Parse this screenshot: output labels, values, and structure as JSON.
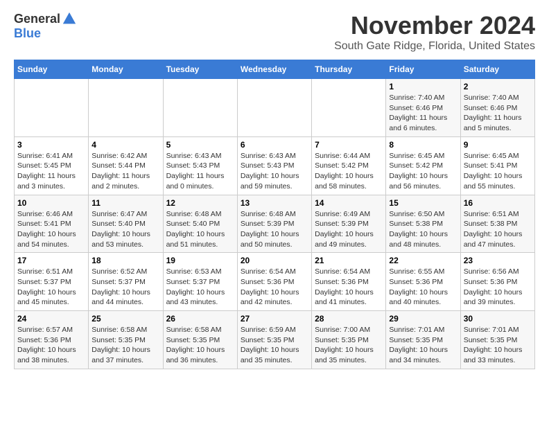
{
  "logo": {
    "general": "General",
    "blue": "Blue"
  },
  "title": {
    "month": "November 2024",
    "location": "South Gate Ridge, Florida, United States"
  },
  "weekdays": [
    "Sunday",
    "Monday",
    "Tuesday",
    "Wednesday",
    "Thursday",
    "Friday",
    "Saturday"
  ],
  "weeks": [
    [
      {
        "day": "",
        "info": ""
      },
      {
        "day": "",
        "info": ""
      },
      {
        "day": "",
        "info": ""
      },
      {
        "day": "",
        "info": ""
      },
      {
        "day": "",
        "info": ""
      },
      {
        "day": "1",
        "info": "Sunrise: 7:40 AM\nSunset: 6:46 PM\nDaylight: 11 hours and 6 minutes."
      },
      {
        "day": "2",
        "info": "Sunrise: 7:40 AM\nSunset: 6:46 PM\nDaylight: 11 hours and 5 minutes."
      }
    ],
    [
      {
        "day": "3",
        "info": "Sunrise: 6:41 AM\nSunset: 5:45 PM\nDaylight: 11 hours and 3 minutes."
      },
      {
        "day": "4",
        "info": "Sunrise: 6:42 AM\nSunset: 5:44 PM\nDaylight: 11 hours and 2 minutes."
      },
      {
        "day": "5",
        "info": "Sunrise: 6:43 AM\nSunset: 5:43 PM\nDaylight: 11 hours and 0 minutes."
      },
      {
        "day": "6",
        "info": "Sunrise: 6:43 AM\nSunset: 5:43 PM\nDaylight: 10 hours and 59 minutes."
      },
      {
        "day": "7",
        "info": "Sunrise: 6:44 AM\nSunset: 5:42 PM\nDaylight: 10 hours and 58 minutes."
      },
      {
        "day": "8",
        "info": "Sunrise: 6:45 AM\nSunset: 5:42 PM\nDaylight: 10 hours and 56 minutes."
      },
      {
        "day": "9",
        "info": "Sunrise: 6:45 AM\nSunset: 5:41 PM\nDaylight: 10 hours and 55 minutes."
      }
    ],
    [
      {
        "day": "10",
        "info": "Sunrise: 6:46 AM\nSunset: 5:41 PM\nDaylight: 10 hours and 54 minutes."
      },
      {
        "day": "11",
        "info": "Sunrise: 6:47 AM\nSunset: 5:40 PM\nDaylight: 10 hours and 53 minutes."
      },
      {
        "day": "12",
        "info": "Sunrise: 6:48 AM\nSunset: 5:40 PM\nDaylight: 10 hours and 51 minutes."
      },
      {
        "day": "13",
        "info": "Sunrise: 6:48 AM\nSunset: 5:39 PM\nDaylight: 10 hours and 50 minutes."
      },
      {
        "day": "14",
        "info": "Sunrise: 6:49 AM\nSunset: 5:39 PM\nDaylight: 10 hours and 49 minutes."
      },
      {
        "day": "15",
        "info": "Sunrise: 6:50 AM\nSunset: 5:38 PM\nDaylight: 10 hours and 48 minutes."
      },
      {
        "day": "16",
        "info": "Sunrise: 6:51 AM\nSunset: 5:38 PM\nDaylight: 10 hours and 47 minutes."
      }
    ],
    [
      {
        "day": "17",
        "info": "Sunrise: 6:51 AM\nSunset: 5:37 PM\nDaylight: 10 hours and 45 minutes."
      },
      {
        "day": "18",
        "info": "Sunrise: 6:52 AM\nSunset: 5:37 PM\nDaylight: 10 hours and 44 minutes."
      },
      {
        "day": "19",
        "info": "Sunrise: 6:53 AM\nSunset: 5:37 PM\nDaylight: 10 hours and 43 minutes."
      },
      {
        "day": "20",
        "info": "Sunrise: 6:54 AM\nSunset: 5:36 PM\nDaylight: 10 hours and 42 minutes."
      },
      {
        "day": "21",
        "info": "Sunrise: 6:54 AM\nSunset: 5:36 PM\nDaylight: 10 hours and 41 minutes."
      },
      {
        "day": "22",
        "info": "Sunrise: 6:55 AM\nSunset: 5:36 PM\nDaylight: 10 hours and 40 minutes."
      },
      {
        "day": "23",
        "info": "Sunrise: 6:56 AM\nSunset: 5:36 PM\nDaylight: 10 hours and 39 minutes."
      }
    ],
    [
      {
        "day": "24",
        "info": "Sunrise: 6:57 AM\nSunset: 5:36 PM\nDaylight: 10 hours and 38 minutes."
      },
      {
        "day": "25",
        "info": "Sunrise: 6:58 AM\nSunset: 5:35 PM\nDaylight: 10 hours and 37 minutes."
      },
      {
        "day": "26",
        "info": "Sunrise: 6:58 AM\nSunset: 5:35 PM\nDaylight: 10 hours and 36 minutes."
      },
      {
        "day": "27",
        "info": "Sunrise: 6:59 AM\nSunset: 5:35 PM\nDaylight: 10 hours and 35 minutes."
      },
      {
        "day": "28",
        "info": "Sunrise: 7:00 AM\nSunset: 5:35 PM\nDaylight: 10 hours and 35 minutes."
      },
      {
        "day": "29",
        "info": "Sunrise: 7:01 AM\nSunset: 5:35 PM\nDaylight: 10 hours and 34 minutes."
      },
      {
        "day": "30",
        "info": "Sunrise: 7:01 AM\nSunset: 5:35 PM\nDaylight: 10 hours and 33 minutes."
      }
    ]
  ]
}
